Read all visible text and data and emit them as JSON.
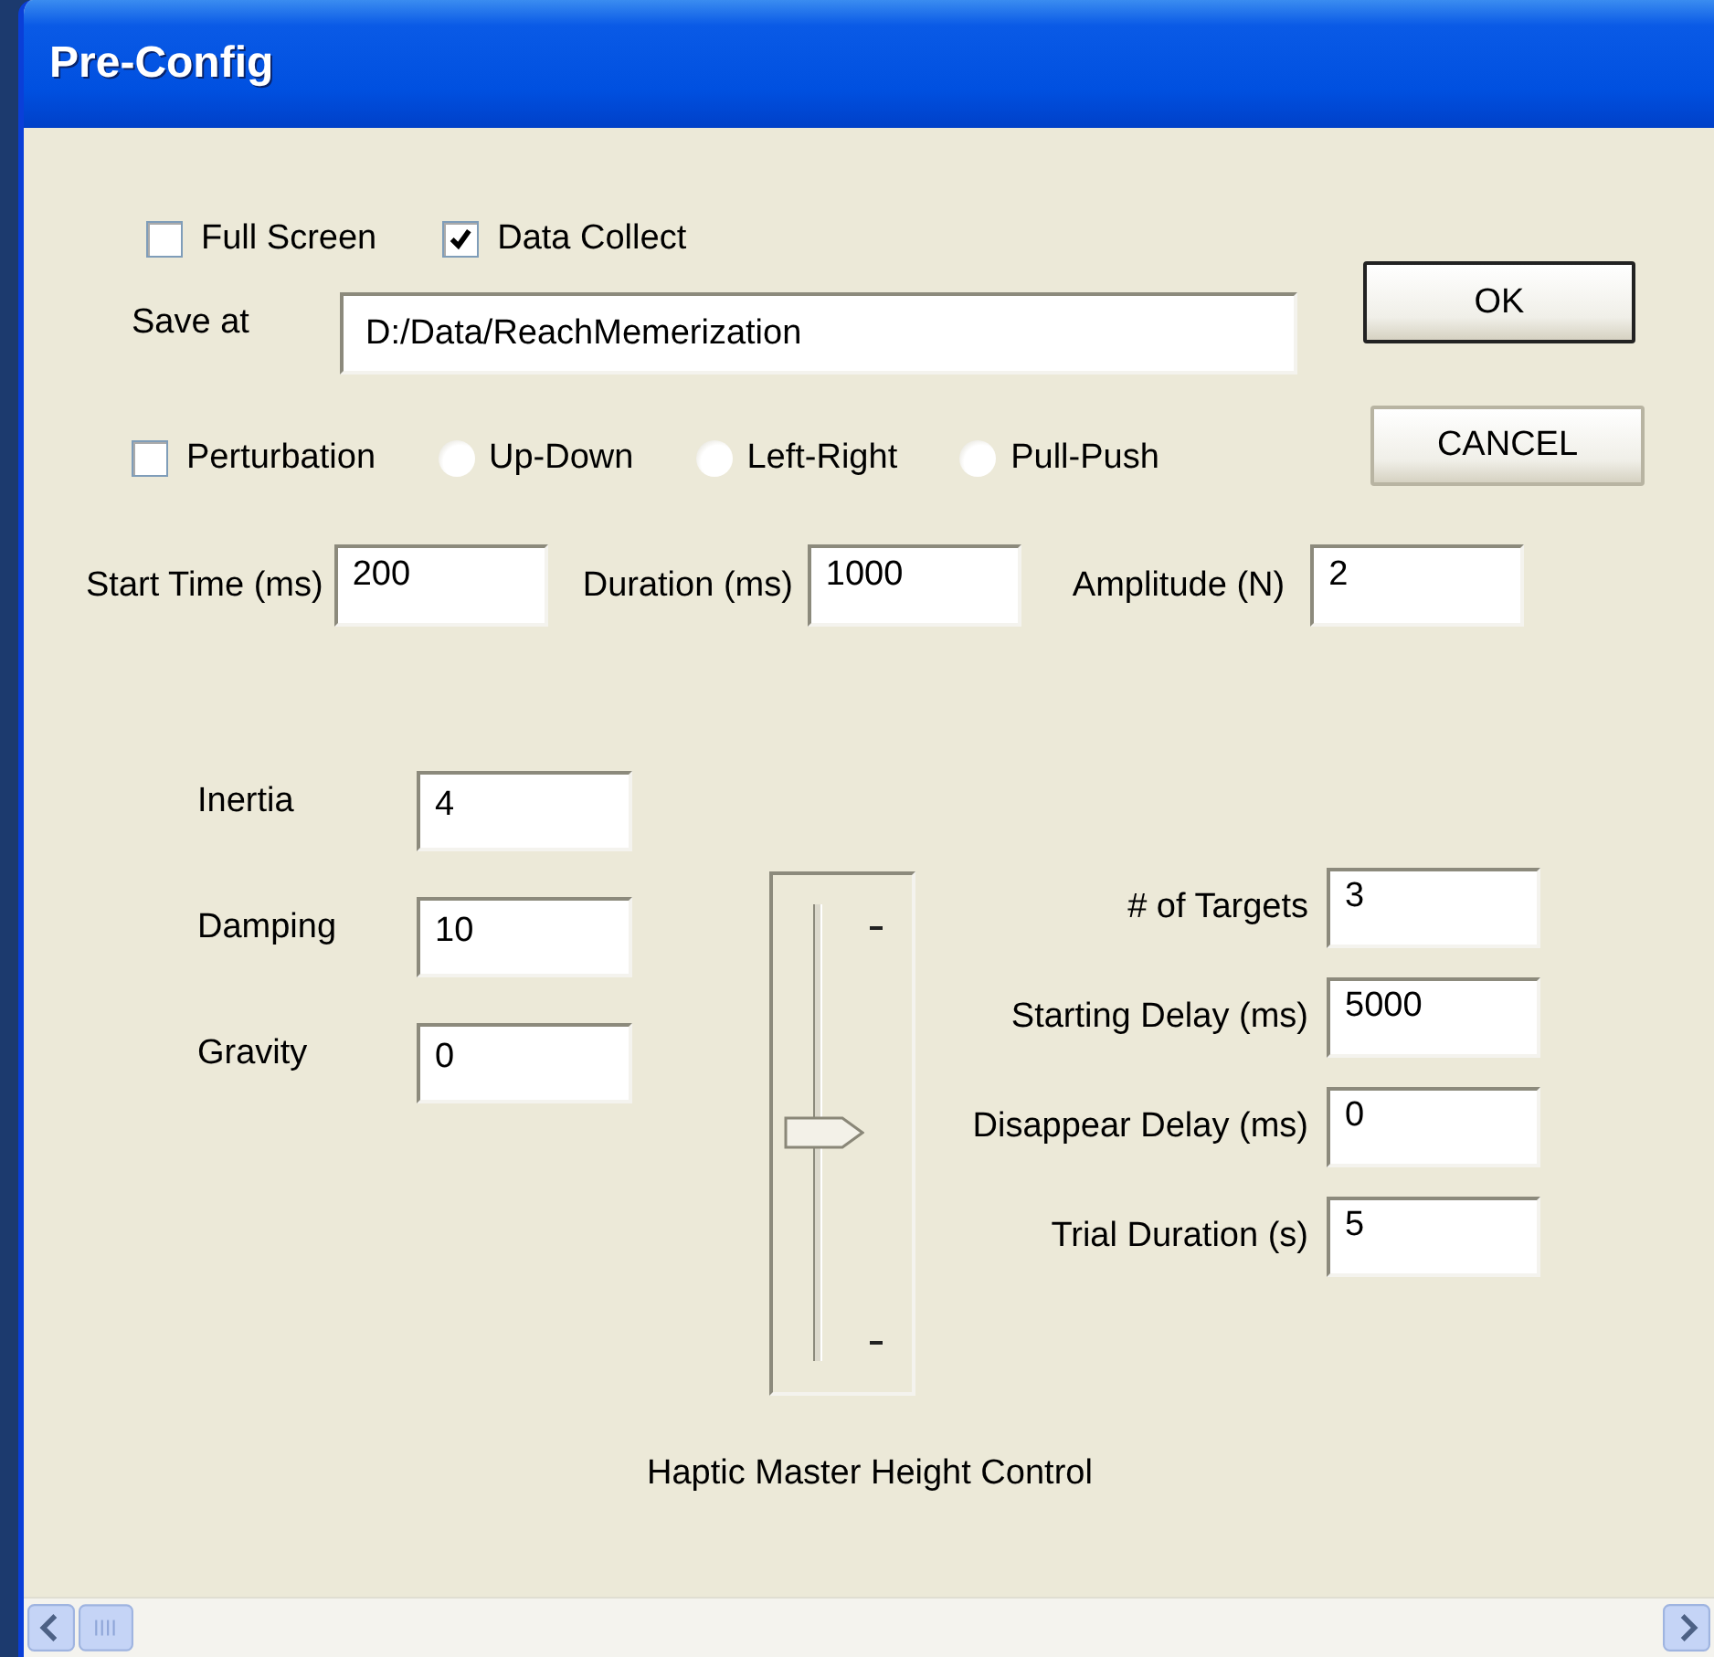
{
  "window": {
    "title": "Pre-Config"
  },
  "options": [
    {
      "label": "Full Screen",
      "checked": false
    },
    {
      "label": "Data Collect",
      "checked": true
    }
  ],
  "save_at": {
    "label": "Save at",
    "value": "D:/Data/ReachMemerization"
  },
  "buttons": [
    {
      "label": "OK",
      "default": true
    },
    {
      "label": "CANCEL",
      "default": false
    }
  ],
  "perturbation": {
    "label": "Perturbation",
    "checked": false
  },
  "directions": [
    {
      "label": "Up-Down",
      "selected": false
    },
    {
      "label": "Left-Right",
      "selected": false
    },
    {
      "label": "Pull-Push",
      "selected": false
    }
  ],
  "timing_fields": [
    {
      "label": "Start Time (ms)",
      "value": "200"
    },
    {
      "label": "Duration (ms)",
      "value": "1000"
    },
    {
      "label": "Amplitude (N)",
      "value": "2"
    }
  ],
  "dynamics_fields": [
    {
      "label": "Inertia",
      "value": "4"
    },
    {
      "label": "Damping",
      "value": "10"
    },
    {
      "label": "Gravity",
      "value": "0"
    }
  ],
  "height_slider": {
    "level": 0.5,
    "caption": "Haptic Master Height Control"
  },
  "target_fields": [
    {
      "label": "# of Targets",
      "value": "3"
    },
    {
      "label": "Starting Delay (ms)",
      "value": "5000"
    },
    {
      "label": "Disappear Delay (ms)",
      "value": "0"
    },
    {
      "label": "Trial Duration (s)",
      "value": "5"
    }
  ]
}
